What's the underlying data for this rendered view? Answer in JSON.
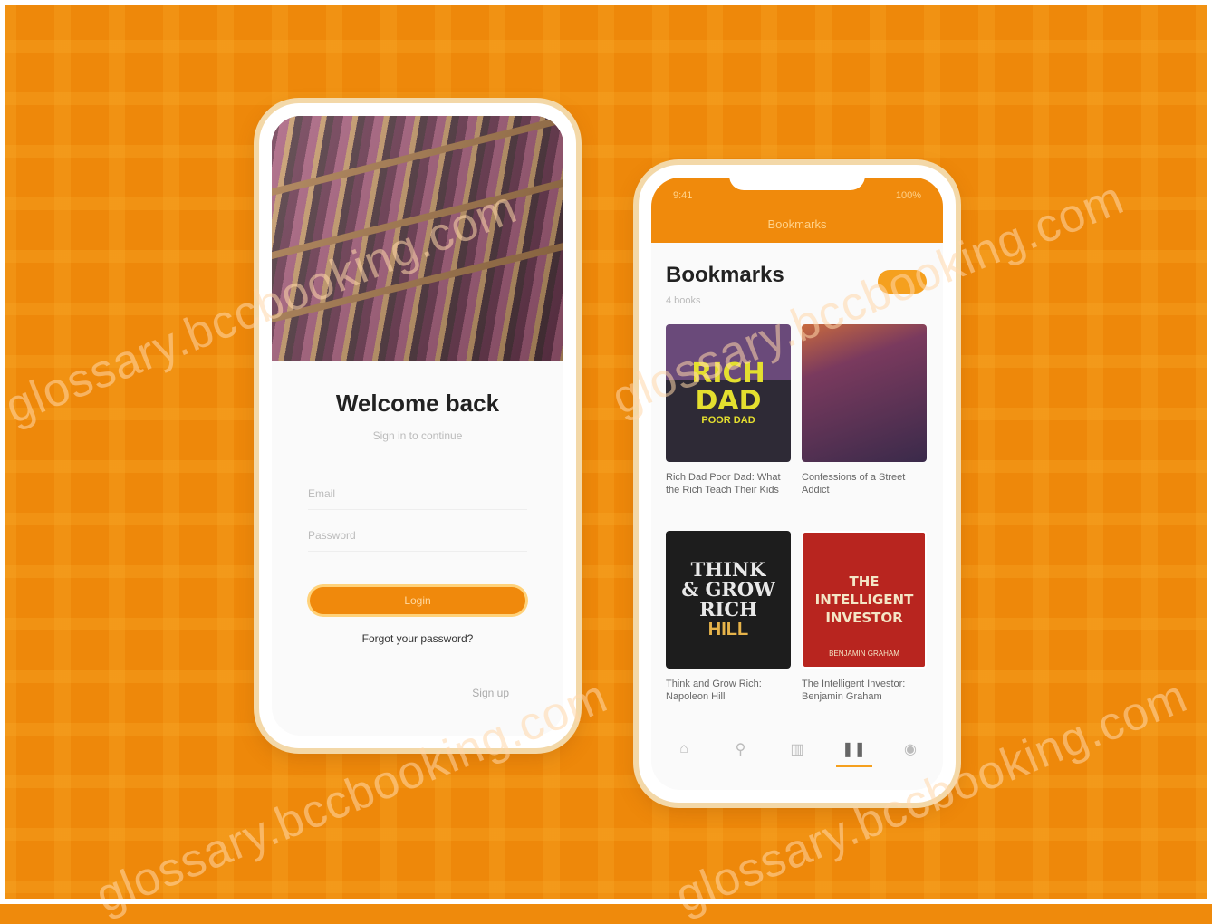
{
  "login_screen": {
    "title": "Welcome back",
    "subtitle": "Sign in to continue",
    "email_label": "Email",
    "password_label": "Password",
    "login_button": "Login",
    "forgot_link": "Forgot your password?",
    "signup_link": "Sign up"
  },
  "bookmarks_screen": {
    "status_time": "9:41",
    "status_battery": "100%",
    "header_title": "Bookmarks",
    "title": "Bookmarks",
    "subtitle": "4 books",
    "books": [
      {
        "cover_line1": "RICH",
        "cover_line2": "DAD",
        "cover_line3": "POOR DAD",
        "title": "Rich Dad Poor Dad: What the Rich Teach Their Kids"
      },
      {
        "cover_line1": "",
        "title": "Confessions of a Street Addict"
      },
      {
        "cover_line1": "THINK",
        "cover_line2": "& GROW",
        "cover_line3": "RICH",
        "cover_line4": "HILL",
        "title": "Think and Grow Rich: Napoleon Hill"
      },
      {
        "cover_line1": "THE",
        "cover_line2": "INTELLIGENT",
        "cover_line3": "INVESTOR",
        "cover_author": "BENJAMIN GRAHAM",
        "title": "The Intelligent Investor: Benjamin Graham"
      }
    ],
    "tabs": [
      {
        "icon": "home-icon",
        "glyph": "⌂"
      },
      {
        "icon": "search-icon",
        "glyph": "⚲"
      },
      {
        "icon": "library-icon",
        "glyph": "▥"
      },
      {
        "icon": "bookmark-icon",
        "glyph": "❚❚"
      },
      {
        "icon": "profile-icon",
        "glyph": "◉"
      }
    ]
  },
  "watermark": "glossary.bccbooking.com",
  "colors": {
    "accent": "#f08a0c",
    "background": "#ee880a"
  }
}
